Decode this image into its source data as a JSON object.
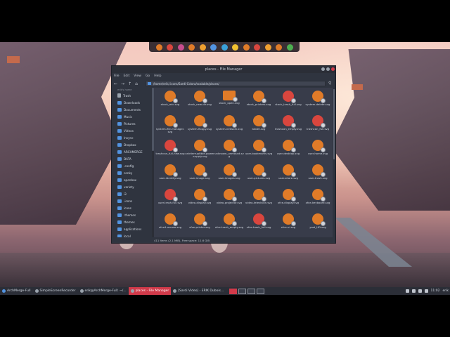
{
  "colors": {
    "accent": "#d13a4a",
    "icon_orange": "#e07b28",
    "folder_blue": "#5294e2",
    "window_bg": "#383c4a"
  },
  "dock": {
    "icons": [
      "firefox-icon",
      "settings-icon",
      "app-icon",
      "app-icon",
      "app-icon",
      "app-icon",
      "app-icon",
      "app-icon",
      "app-icon",
      "app-icon",
      "app-icon",
      "app-icon",
      "app-icon"
    ]
  },
  "window": {
    "title": "places - File Manager",
    "menu": [
      "File",
      "Edit",
      "View",
      "Go",
      "Help"
    ],
    "path": "/home/erik/.icons/Sardi-Colora/scalable/places/",
    "sidebar": {
      "header": "erik's home",
      "items": [
        {
          "label": "Trash",
          "icon": "trash-icon"
        },
        {
          "label": "Downloads",
          "icon": "folder-icon"
        },
        {
          "label": "Documents",
          "icon": "folder-icon"
        },
        {
          "label": "Music",
          "icon": "folder-icon"
        },
        {
          "label": "Pictures",
          "icon": "folder-icon"
        },
        {
          "label": "Videos",
          "icon": "folder-icon"
        },
        {
          "label": "Insync",
          "icon": "folder-icon"
        },
        {
          "label": "Dropbox",
          "icon": "folder-icon"
        },
        {
          "label": "ARCHMERGE",
          "icon": "folder-icon"
        },
        {
          "label": "DATA",
          "icon": "folder-icon"
        },
        {
          "label": ".config",
          "icon": "folder-icon"
        },
        {
          "label": "conky",
          "icon": "folder-icon"
        },
        {
          "label": "openbox",
          "icon": "folder-icon"
        },
        {
          "label": "variety",
          "icon": "folder-icon"
        },
        {
          "label": "i3",
          "icon": "folder-icon"
        },
        {
          "label": ".icons",
          "icon": "folder-icon"
        },
        {
          "label": "icons",
          "icon": "folder-icon"
        },
        {
          "label": ".themes",
          "icon": "folder-icon"
        },
        {
          "label": "themes",
          "icon": "folder-icon"
        },
        {
          "label": "applications",
          "icon": "folder-icon"
        },
        {
          "label": "local",
          "icon": "folder-icon"
        }
      ]
    },
    "files": [
      {
        "label": "stock_mic.svg",
        "kind": "round"
      },
      {
        "label": "stock_new-dir.svg",
        "kind": "round"
      },
      {
        "label": "stock_open.svg",
        "kind": "folder"
      },
      {
        "label": "stock_printers.svg",
        "kind": "round"
      },
      {
        "label": "stock_trash_full.svg",
        "kind": "red"
      },
      {
        "label": "system-delete.svg",
        "kind": "round"
      },
      {
        "label": "system-file-manager.svg",
        "kind": "round"
      },
      {
        "label": "system-floppy.svg",
        "kind": "round"
      },
      {
        "label": "system-network.svg",
        "kind": "round"
      },
      {
        "label": "tablet.svg",
        "kind": "round"
      },
      {
        "label": "trashcan_empty.svg",
        "kind": "red"
      },
      {
        "label": "trashcan_full.svg",
        "kind": "red"
      },
      {
        "label": "trashcan_full-new.svg",
        "kind": "red"
      },
      {
        "label": "uninterruptible-power-supply.svg",
        "kind": "round"
      },
      {
        "label": "unknown_unmount.svg",
        "kind": "round"
      },
      {
        "label": "user-bookmarks.svg",
        "kind": "round"
      },
      {
        "label": "user-desktop.svg",
        "kind": "round"
      },
      {
        "label": "user-home.svg",
        "kind": "round"
      },
      {
        "label": "user-identity.svg",
        "kind": "round"
      },
      {
        "label": "user-image.svg",
        "kind": "round"
      },
      {
        "label": "user-images.svg",
        "kind": "round"
      },
      {
        "label": "user-pictures.svg",
        "kind": "round"
      },
      {
        "label": "user-share.svg",
        "kind": "round"
      },
      {
        "label": "user-trash.svg",
        "kind": "round"
      },
      {
        "label": "user-trash-full.svg",
        "kind": "red"
      },
      {
        "label": "video-display.svg",
        "kind": "round"
      },
      {
        "label": "video-projector.svg",
        "kind": "round"
      },
      {
        "label": "video-television.svg",
        "kind": "round"
      },
      {
        "label": "xfce-display.svg",
        "kind": "round"
      },
      {
        "label": "xfce-keyboard.svg",
        "kind": "round"
      },
      {
        "label": "xfce4-mouse.svg",
        "kind": "round"
      },
      {
        "label": "xfce-printer.svg",
        "kind": "round"
      },
      {
        "label": "xfce-trash_empty.svg",
        "kind": "round"
      },
      {
        "label": "xfce-trash_full.svg",
        "kind": "red"
      },
      {
        "label": "xfce-ui.svg",
        "kind": "round"
      },
      {
        "label": "yast_HD.svg",
        "kind": "round"
      },
      {
        "label": "",
        "kind": "round"
      },
      {
        "label": "",
        "kind": "round"
      },
      {
        "label": "",
        "kind": "round"
      },
      {
        "label": "",
        "kind": "round"
      },
      {
        "label": "",
        "kind": "round"
      },
      {
        "label": "",
        "kind": "round"
      }
    ],
    "status": "411 items (2.1 MiB), Free space: 11.6 GiB"
  },
  "taskbar": {
    "menu_label": "ArchMerge-Full",
    "tasks": [
      {
        "label": "SimpleScreenRecorder",
        "active": false
      },
      {
        "label": "erik@ArchMerge-Full: ~/...",
        "active": false
      },
      {
        "label": "places - File Manager",
        "active": true
      },
      {
        "label": "[Sardi Video] - ERIK Dubois...",
        "active": false
      }
    ],
    "workspaces": [
      "1",
      "2",
      "3",
      "4"
    ],
    "clock": "11:02",
    "user": "erik"
  }
}
